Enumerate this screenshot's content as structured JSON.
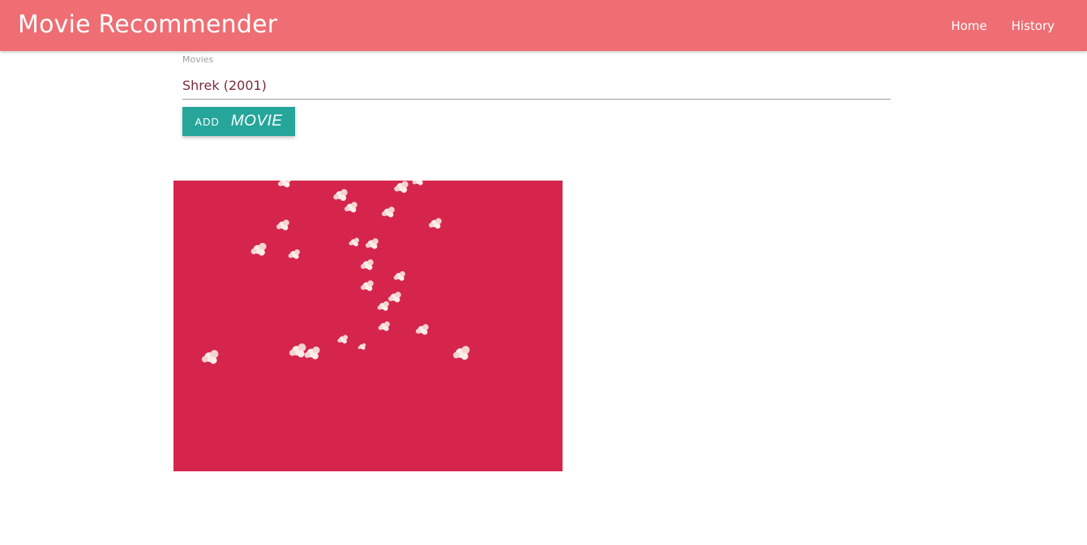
{
  "navbar": {
    "brand": "Movie Recommender",
    "links": [
      "Home",
      "History"
    ],
    "color": "#ee6e73"
  },
  "form": {
    "label": "Movies",
    "value": "Shrek (2001)",
    "button": {
      "word1": "ADD",
      "word2": "MOVIE",
      "color": "#26a69a"
    }
  },
  "animation": {
    "background": "#d5254d",
    "particle_icon": "popcorn-icon"
  }
}
